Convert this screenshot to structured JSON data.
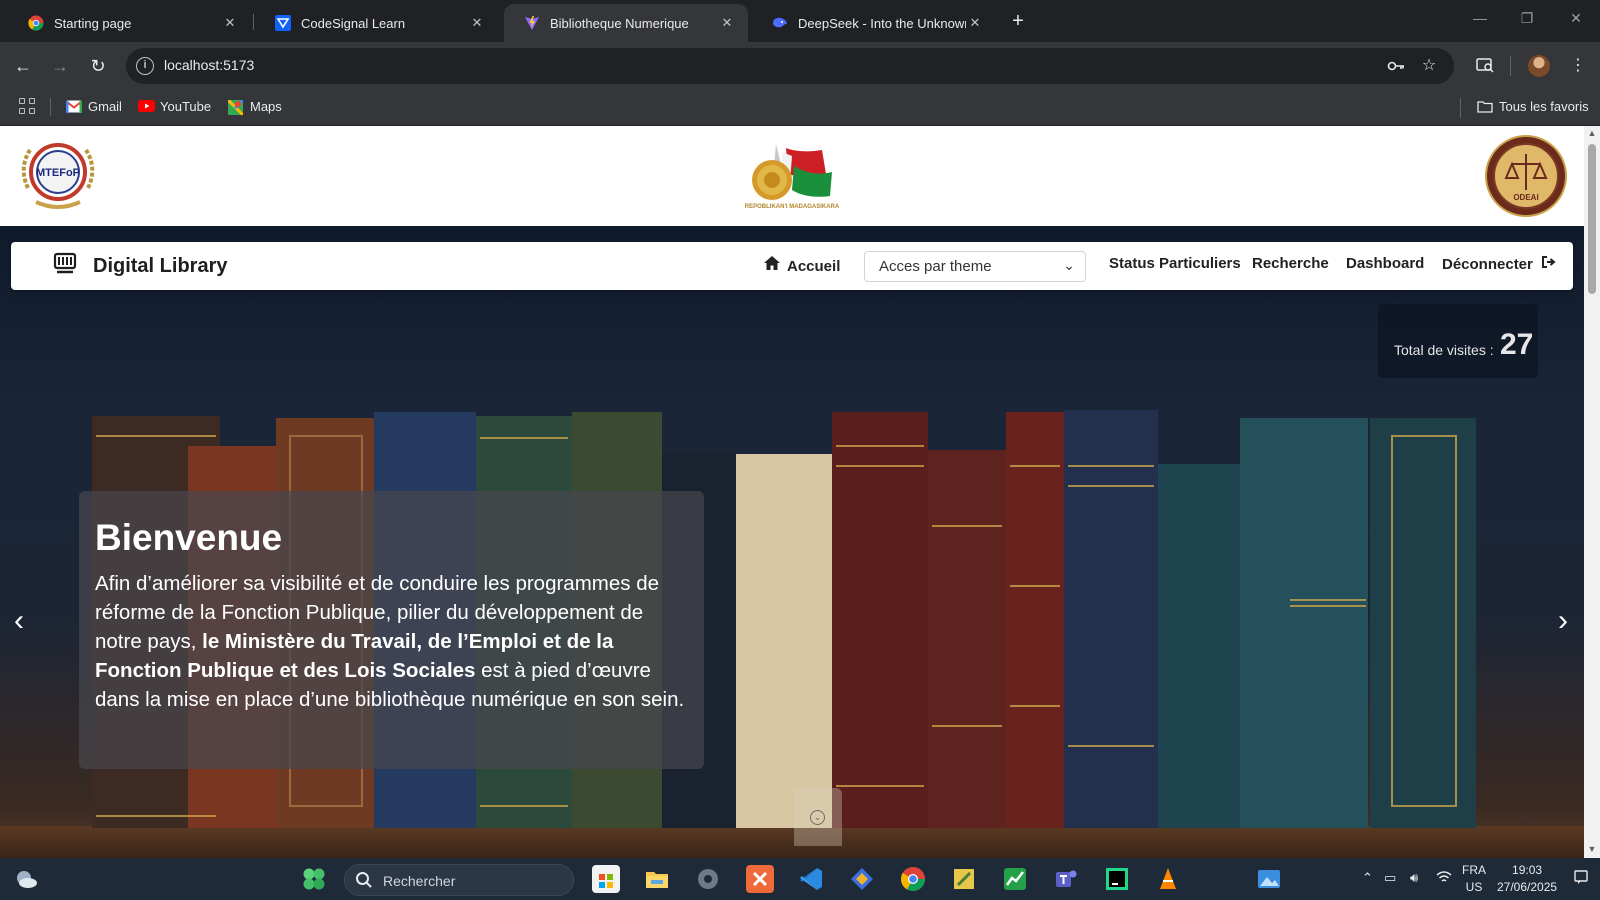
{
  "browser": {
    "tabs": [
      {
        "title": "Starting page",
        "favicon": "chrome-icon"
      },
      {
        "title": "CodeSignal Learn",
        "favicon": "codesignal-icon"
      },
      {
        "title": "Bibliotheque Numerique",
        "favicon": "vite-icon",
        "active": true
      },
      {
        "title": "DeepSeek - Into the Unknown",
        "favicon": "deepseek-icon"
      }
    ],
    "url": "localhost:5173",
    "bookmarks": [
      {
        "label": "Gmail",
        "icon": "gmail-icon"
      },
      {
        "label": "YouTube",
        "icon": "youtube-icon"
      },
      {
        "label": "Maps",
        "icon": "maps-icon"
      }
    ],
    "all_bookmarks_label": "Tous les favoris"
  },
  "site": {
    "header": {
      "logo_left_text": "MTEFoP",
      "logo_center_caption": "REPOBLIKAN'I MADAGASIKARA",
      "logo_right_text": "ODEAI"
    },
    "navbar": {
      "brand": "Digital Library",
      "home": "Accueil",
      "theme_select": "Acces par theme",
      "links": [
        "Status Particuliers",
        "Recherche",
        "Dashboard",
        "Déconnecter"
      ]
    },
    "visits": {
      "label": "Total de visites :",
      "count": "27"
    },
    "hero": {
      "title": "Bienvenue",
      "text_before": "Afin d’améliorer sa visibilité et de conduire les programmes de réforme de la Fonction Publique, pilier du développement de notre pays,",
      "text_bold": "le Ministère du Travail, de l’Emploi et de la Fonction Publique et des Lois Sociales",
      "text_after": "est à pied d’œuvre dans la mise en place d’une bibliothèque numérique en son sein."
    }
  },
  "taskbar": {
    "search_placeholder": "Rechercher",
    "lang": "FRA",
    "region": "US",
    "time": "19:03",
    "date": "27/06/2025"
  },
  "colors": {
    "browser_bg": "#202124",
    "toolbar": "#35363a",
    "hero_dark": "#1a2638",
    "taskbar": "#1f2a38"
  }
}
